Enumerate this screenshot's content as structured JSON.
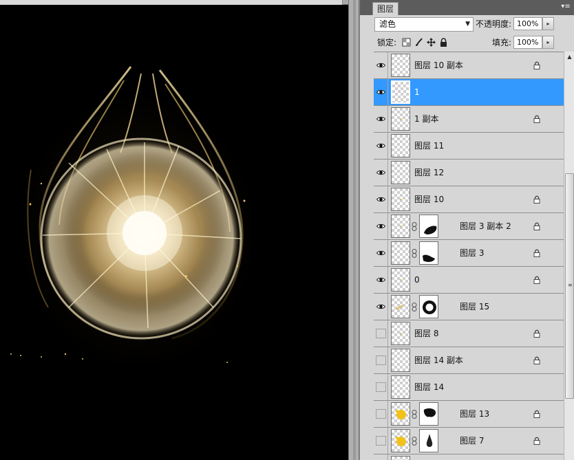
{
  "panel": {
    "tab_label": "图层",
    "menu_glyph": "▾≡",
    "blend_mode": "滤色",
    "opacity_label": "不透明度:",
    "opacity_value": "100%",
    "lock_label": "锁定:",
    "fill_label": "填充:",
    "fill_value": "100%"
  },
  "layers": [
    {
      "name": "图层 10 副本",
      "visible": true,
      "selected": false,
      "locked": true,
      "mask": null,
      "thumb": "blank"
    },
    {
      "name": "1",
      "visible": true,
      "selected": true,
      "locked": false,
      "mask": null,
      "thumb": "blank"
    },
    {
      "name": "1 副本",
      "visible": true,
      "selected": false,
      "locked": true,
      "mask": null,
      "thumb": "speck"
    },
    {
      "name": "图层 11",
      "visible": true,
      "selected": false,
      "locked": false,
      "mask": null,
      "thumb": "blank"
    },
    {
      "name": "图层 12",
      "visible": true,
      "selected": false,
      "locked": false,
      "mask": null,
      "thumb": "blank"
    },
    {
      "name": "图层 10",
      "visible": true,
      "selected": false,
      "locked": true,
      "mask": null,
      "thumb": "speck"
    },
    {
      "name": "图层 3 副本 2",
      "visible": true,
      "selected": false,
      "locked": true,
      "mask": "blob-right",
      "thumb": "speck"
    },
    {
      "name": "图层 3",
      "visible": true,
      "selected": false,
      "locked": true,
      "mask": "blob-left",
      "thumb": "blank"
    },
    {
      "name": "0",
      "visible": true,
      "selected": false,
      "locked": true,
      "mask": null,
      "thumb": "speck"
    },
    {
      "name": "图层 15",
      "visible": true,
      "selected": false,
      "locked": false,
      "mask": "ring",
      "thumb": "speck-gold"
    },
    {
      "name": "图层 8",
      "visible": false,
      "selected": false,
      "locked": true,
      "mask": null,
      "thumb": "speck"
    },
    {
      "name": "图层 14 副本",
      "visible": false,
      "selected": false,
      "locked": true,
      "mask": null,
      "thumb": "blank"
    },
    {
      "name": "图层 14",
      "visible": false,
      "selected": false,
      "locked": false,
      "mask": null,
      "thumb": "blank"
    },
    {
      "name": "图层 13",
      "visible": false,
      "selected": false,
      "locked": true,
      "mask": "splat",
      "thumb": "gold-blob"
    },
    {
      "name": "图层 7",
      "visible": false,
      "selected": false,
      "locked": true,
      "mask": "drop",
      "thumb": "gold-blob"
    },
    {
      "name": "",
      "visible": false,
      "selected": false,
      "locked": false,
      "mask": null,
      "thumb": "blank"
    }
  ],
  "colors": {
    "selection": "#3399ff",
    "panel_bg": "#d6d6d6",
    "canvas_bg": "#000000",
    "glow_gold": "#e8c26a"
  },
  "icons": {
    "eye": "eye-icon",
    "lock": "lock-icon",
    "chain": "chain-link-icon"
  }
}
